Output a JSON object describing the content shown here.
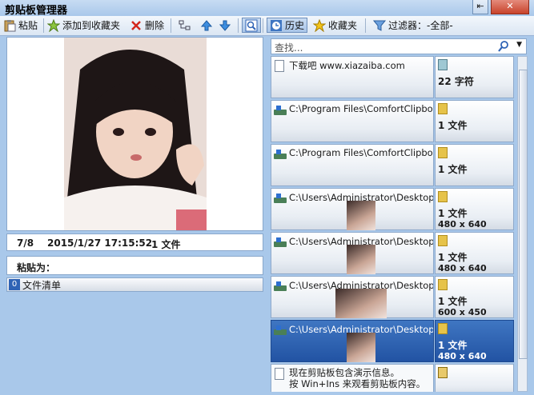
{
  "window": {
    "title": "剪贴板管理器",
    "restore_glyph": "⇤",
    "close_glyph": "✕"
  },
  "toolbar": {
    "paste_label": "粘贴",
    "add_favorite_label": "添加到收藏夹",
    "delete_label": "删除",
    "history_label": "历史",
    "favorites_label": "收藏夹",
    "filter_label": "过滤器：",
    "filter_value": "-全部-"
  },
  "preview": {
    "index": "7/8",
    "timestamp": "2015/1/27 17:15:52",
    "summary": "1 文件",
    "paste_as_label": "粘贴为：",
    "file_list_count": "0",
    "file_list_label": "文件清单"
  },
  "search": {
    "placeholder": "查找..."
  },
  "list": {
    "items": [
      {
        "type": "text",
        "path": "下载吧 www.xiazaiba.com",
        "line1": "22 字符",
        "line2": ""
      },
      {
        "type": "files",
        "path": "C:\\Program Files\\ComfortClipboard\\B",
        "line1": "1 文件",
        "line2": ""
      },
      {
        "type": "files",
        "path": "C:\\Program Files\\ComfortClipboard\\C",
        "line1": "1 文件",
        "line2": ""
      },
      {
        "type": "image",
        "path": "C:\\Users\\Administrator\\Desktop\\爱须",
        "line1": "1 文件",
        "line2": "480 x 640"
      },
      {
        "type": "image",
        "path": "C:\\Users\\Administrator\\Desktop\\爱须",
        "line1": "1 文件",
        "line2": "480 x 640"
      },
      {
        "type": "image",
        "path": "C:\\Users\\Administrator\\Desktop\\爱须",
        "line1": "1 文件",
        "line2": "600 x 450"
      },
      {
        "type": "image",
        "path": "C:\\Users\\Administrator\\Desktop\\爱须",
        "line1": "1 文件",
        "line2": "480 x 640",
        "selected": true
      }
    ],
    "info": {
      "line1": "现在剪贴板包含演示信息。",
      "line2": "按 Win+Ins 来观看剪贴板内容。"
    }
  },
  "colors": {
    "background": "#a9c8ea",
    "selection": "#2f63b5"
  }
}
